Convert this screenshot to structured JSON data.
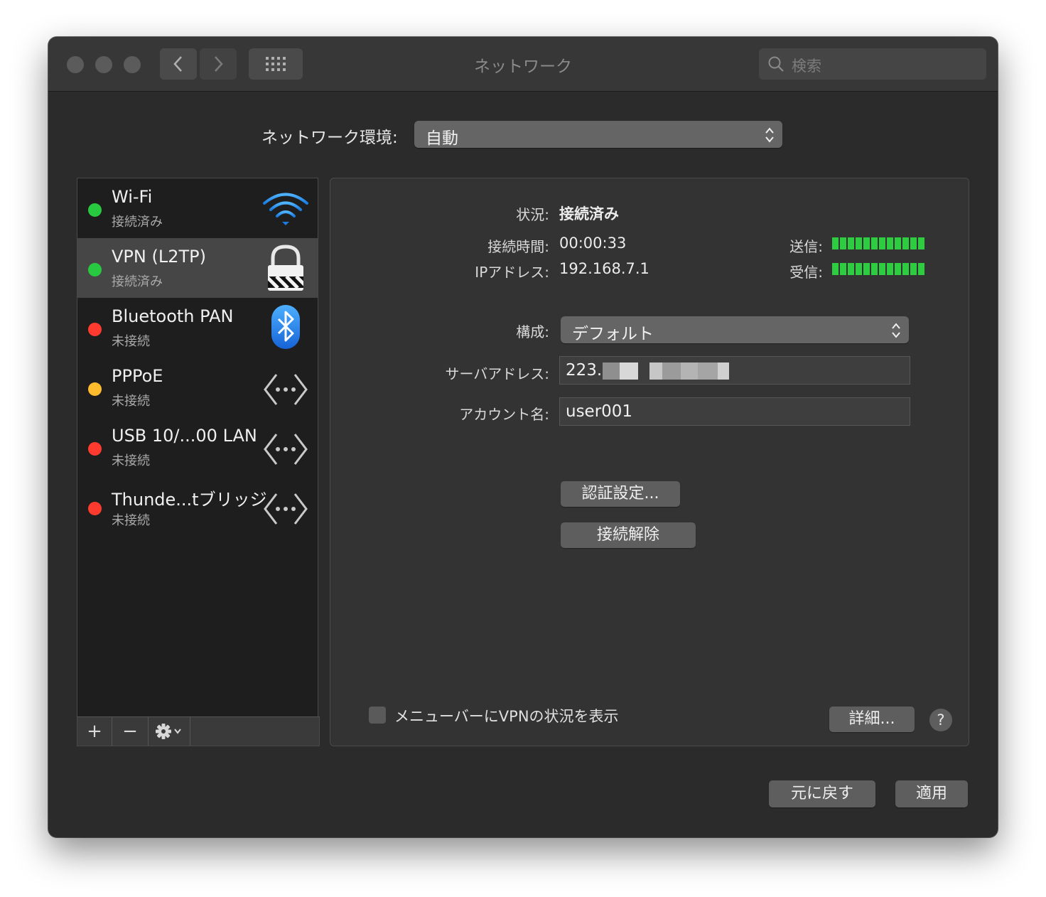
{
  "window": {
    "title": "ネットワーク"
  },
  "search": {
    "placeholder": "検索"
  },
  "location": {
    "label": "ネットワーク環境:",
    "value": "自動"
  },
  "services": [
    {
      "name": "Wi-Fi",
      "status": "接続済み",
      "dot": "#28c940",
      "icon": "wifi-icon",
      "selected": false
    },
    {
      "name": "VPN (L2TP)",
      "status": "接続済み",
      "dot": "#28c940",
      "icon": "vpn-lock-icon",
      "selected": true
    },
    {
      "name": "Bluetooth PAN",
      "status": "未接続",
      "dot": "#ff3b30",
      "icon": "bluetooth-icon",
      "selected": false
    },
    {
      "name": "PPPoE",
      "status": "未接続",
      "dot": "#ffbd2e",
      "icon": "ethernet-arrows-icon",
      "selected": false
    },
    {
      "name": "USB 10/...00 LAN",
      "status": "未接続",
      "dot": "#ff3b30",
      "icon": "ethernet-arrows-icon",
      "selected": false
    },
    {
      "name": "Thunde...tブリッジ",
      "status": "未接続",
      "dot": "#ff3b30",
      "icon": "ethernet-arrows-icon",
      "selected": false
    }
  ],
  "sidebar_footer": {
    "add": "+",
    "remove": "−"
  },
  "detail": {
    "status_label": "状況:",
    "status_value": "接続済み",
    "time_label": "接続時間:",
    "time_value": "00:00:33",
    "ip_label": "IPアドレス:",
    "ip_value": "192.168.7.1",
    "send_label": "送信:",
    "recv_label": "受信:",
    "send_level": 1.0,
    "recv_level": 1.0,
    "config_label": "構成:",
    "config_value": "デフォルト",
    "server_label": "サーバアドレス:",
    "server_value": "223.",
    "account_label": "アカウント名:",
    "account_value": "user001",
    "auth_button": "認証設定...",
    "disconnect_button": "接続解除",
    "menubar_checkbox": "メニューバーにVPNの状況を表示",
    "advanced_button": "詳細...",
    "help": "?"
  },
  "footer": {
    "revert": "元に戻す",
    "apply": "適用"
  },
  "colors": {
    "meter": "#2ecc40",
    "window": "#2b2b2b"
  }
}
